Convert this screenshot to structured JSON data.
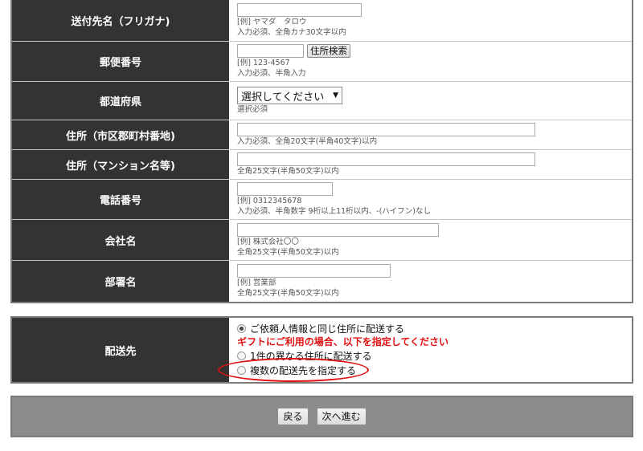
{
  "form": {
    "rows": [
      {
        "label": "送付先名（フリガナ)",
        "example": "[例] ヤマダ　タロウ",
        "note": "入力必須、全角カナ30文字以内"
      },
      {
        "label": "郵便番号",
        "example": "[例] 123-4567",
        "note": "入力必須、半角入力",
        "button": "住所検索"
      },
      {
        "label": "都道府県",
        "select_value": "選択してください",
        "note": "選択必須"
      },
      {
        "label": "住所（市区郡町村番地)",
        "note": "入力必須、全角20文字(半角40文字)以内"
      },
      {
        "label": "住所（マンション名等)",
        "note": "全角25文字(半角50文字)以内"
      },
      {
        "label": "電話番号",
        "example": "[例] 0312345678",
        "note": "入力必須、半角数字 9桁以上11桁以内、-(ハイフン)なし"
      },
      {
        "label": "会社名",
        "example": "[例] 株式会社〇〇",
        "note": "全角25文字(半角50文字)以内"
      },
      {
        "label": "部署名",
        "example": "[例] 営業部",
        "note": "全角25文字(半角50文字)以内"
      }
    ]
  },
  "delivery": {
    "label": "配送先",
    "option_same": "ご依頼人情報と同じ住所に配送する",
    "gift_note": "ギフトにご利用の場合、以下を指定してください",
    "option_other": "1件の異なる住所に配送する",
    "option_multi": "複数の配送先を指定する"
  },
  "footer": {
    "back": "戻る",
    "next": "次へ進む"
  },
  "colors": {
    "header_bg": "#333333",
    "annotation": "#e01010",
    "footer_bg": "#8c8c8c"
  }
}
